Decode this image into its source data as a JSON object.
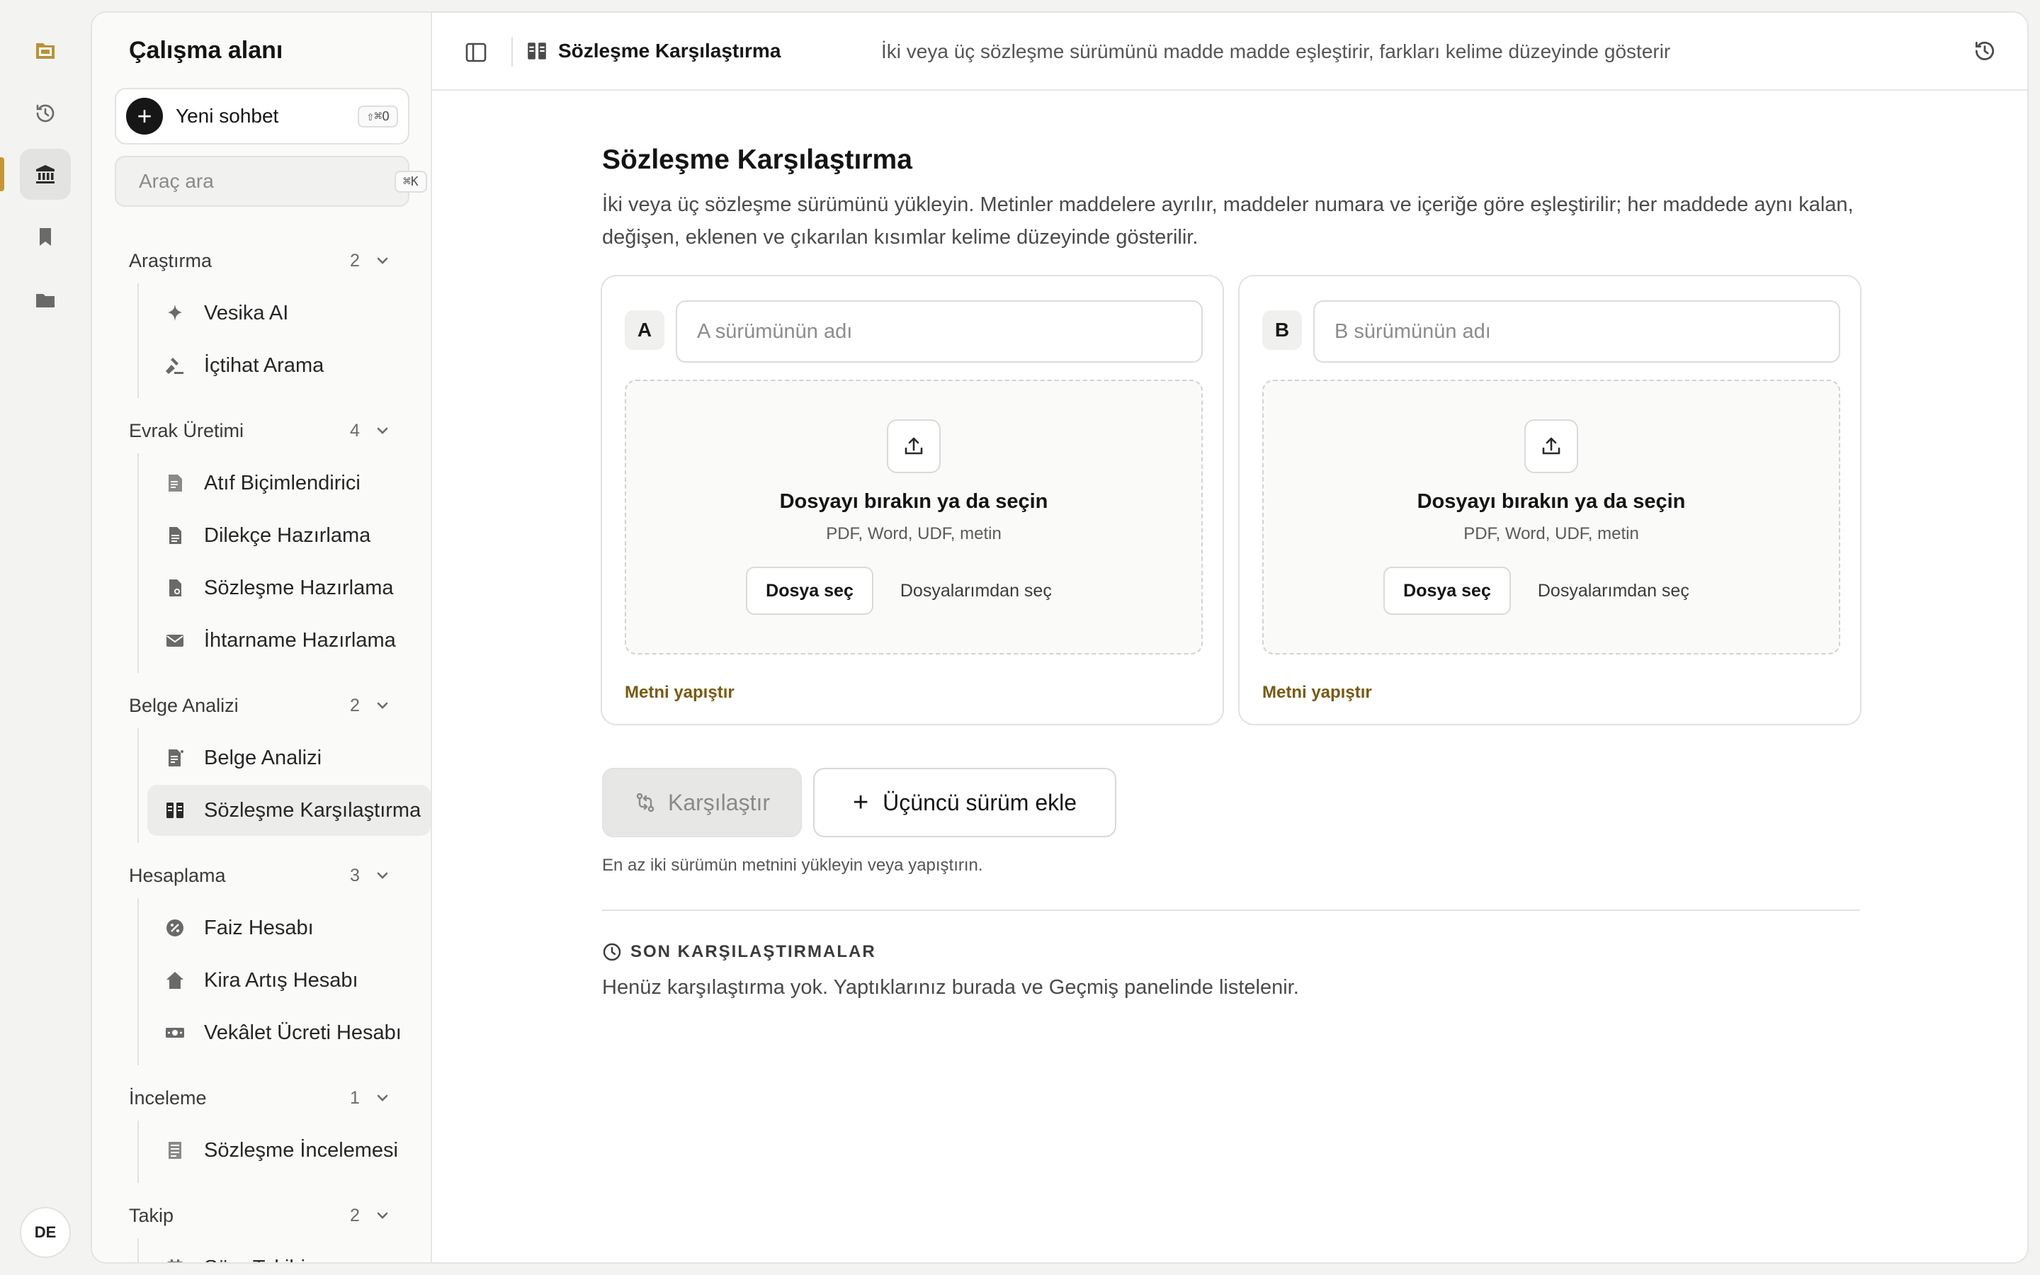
{
  "sidebar": {
    "title": "Çalışma alanı",
    "new_chat": {
      "label": "Yeni sohbet",
      "shortcut": "⇧⌘O"
    },
    "search": {
      "placeholder": "Araç ara",
      "shortcut": "⌘K"
    },
    "groups": [
      {
        "name": "Araştırma",
        "count": "2",
        "items": [
          {
            "label": "Vesika AI",
            "icon": "sparkle-icon"
          },
          {
            "label": "İçtihat Arama",
            "icon": "gavel-icon"
          }
        ]
      },
      {
        "name": "Evrak Üretimi",
        "count": "4",
        "items": [
          {
            "label": "Atıf Biçimlendirici",
            "icon": "citation-doc-icon"
          },
          {
            "label": "Dilekçe Hazırlama",
            "icon": "document-icon"
          },
          {
            "label": "Sözleşme Hazırlama",
            "icon": "contract-doc-icon"
          },
          {
            "label": "İhtarname Hazırlama",
            "icon": "envelope-icon"
          }
        ]
      },
      {
        "name": "Belge Analizi",
        "count": "2",
        "items": [
          {
            "label": "Belge Analizi",
            "icon": "doc-analysis-icon"
          },
          {
            "label": "Sözleşme Karşılaştırma",
            "icon": "compare-columns-icon",
            "active": true
          }
        ]
      },
      {
        "name": "Hesaplama",
        "count": "3",
        "items": [
          {
            "label": "Faiz Hesabı",
            "icon": "percent-icon"
          },
          {
            "label": "Kira Artış Hesabı",
            "icon": "house-icon"
          },
          {
            "label": "Vekâlet Ücreti Hesabı",
            "icon": "banknote-icon"
          }
        ]
      },
      {
        "name": "İnceleme",
        "count": "1",
        "items": [
          {
            "label": "Sözleşme İncelemesi",
            "icon": "review-doc-icon"
          }
        ]
      },
      {
        "name": "Takip",
        "count": "2",
        "items": [
          {
            "label": "Süre Takibi",
            "icon": "calendar-icon"
          }
        ]
      }
    ]
  },
  "rail": {
    "avatar": "DE",
    "icons": [
      "logo-icon",
      "history-icon",
      "bank-icon",
      "bookmark-icon",
      "folder-icon"
    ]
  },
  "topbar": {
    "title": "Sözleşme Karşılaştırma",
    "description": "İki veya üç sözleşme sürümünü madde madde eşleştirir, farkları kelime düzeyinde gösterir"
  },
  "main": {
    "title": "Sözleşme Karşılaştırma",
    "description": "İki veya üç sözleşme sürümünü yükleyin. Metinler maddelere ayrılır, maddeler numara ve içeriğe göre eşleştirilir; her maddede aynı kalan, değişen, eklenen ve çıkarılan kısımlar kelime düzeyinde gösterilir.",
    "versions": [
      {
        "letter": "A",
        "name_placeholder": "A sürümünün adı",
        "drop_title": "Dosyayı bırakın ya da seçin",
        "formats": "PDF, Word, UDF, metin",
        "choose_file": "Dosya seç",
        "choose_from_files": "Dosyalarımdan seç",
        "paste_text": "Metni yapıştır"
      },
      {
        "letter": "B",
        "name_placeholder": "B sürümünün adı",
        "drop_title": "Dosyayı bırakın ya da seçin",
        "formats": "PDF, Word, UDF, metin",
        "choose_file": "Dosya seç",
        "choose_from_files": "Dosyalarımdan seç",
        "paste_text": "Metni yapıştır"
      }
    ],
    "compare_label": "Karşılaştır",
    "add_third_label": "Üçüncü sürüm ekle",
    "hint": "En az iki sürümün metnini yükleyin veya yapıştırın.",
    "recent": {
      "title": "SON KARŞILAŞTIRMALAR",
      "empty": "Henüz karşılaştırma yok. Yaptıklarınız burada ve Geçmiş panelinde listelenir."
    }
  },
  "colors": {
    "accent": "#c9962d",
    "link": "#7a5a10",
    "ink": "#141414"
  }
}
